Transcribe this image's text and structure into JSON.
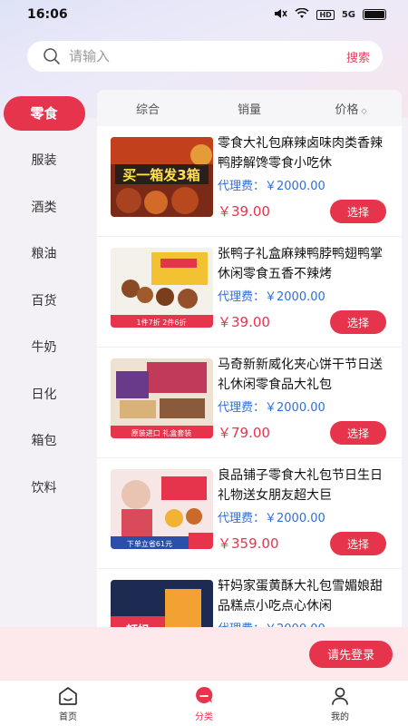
{
  "status": {
    "time": "16:06",
    "signal_text": "5G",
    "hd_text": "HD"
  },
  "search": {
    "placeholder": "请输入",
    "button_label": "搜索"
  },
  "sidebar": {
    "items": [
      {
        "label": "零食",
        "active": true
      },
      {
        "label": "服装"
      },
      {
        "label": "酒类"
      },
      {
        "label": "粮油"
      },
      {
        "label": "百货"
      },
      {
        "label": "牛奶"
      },
      {
        "label": "日化"
      },
      {
        "label": "箱包"
      },
      {
        "label": "饮料"
      }
    ]
  },
  "sort_tabs": [
    {
      "label": "综合"
    },
    {
      "label": "销量"
    },
    {
      "label": "价格",
      "icon": "sort-arrows-icon",
      "icon_glyph": "⬦"
    }
  ],
  "products": [
    {
      "title": "零食大礼包麻辣卤味肉类香辣鸭脖解馋零食小吃休",
      "agent_fee": "代理费：￥2000.00",
      "price": "￥39.00",
      "button": "选择",
      "image_text": "买一箱发3箱"
    },
    {
      "title": "张鸭子礼盒麻辣鸭脖鸭翅鸭掌休闲零食五香不辣烤",
      "agent_fee": "代理费：￥2000.00",
      "price": "￥39.00",
      "button": "选择",
      "image_text": "1件7折 2件6折"
    },
    {
      "title": "马奇新新威化夹心饼干节日送礼休闲零食品大礼包",
      "agent_fee": "代理费：￥2000.00",
      "price": "￥79.00",
      "button": "选择",
      "image_text": "原装进口 礼盒套装"
    },
    {
      "title": "良品铺子零食大礼包节日生日礼物送女朋友超大巨",
      "agent_fee": "代理费：￥2000.00",
      "price": "￥359.00",
      "button": "选择",
      "image_text": "下单立省61元"
    },
    {
      "title": "轩妈家蛋黄酥大礼包雪媚娘甜品糕点小吃点心休闲",
      "agent_fee": "代理费：￥2000.00",
      "price": "",
      "button": "",
      "image_text": "轩妈"
    }
  ],
  "login": {
    "button_label": "请先登录"
  },
  "tabbar": [
    {
      "label": "首页",
      "icon": "home-icon"
    },
    {
      "label": "分类",
      "icon": "category-icon",
      "active": true
    },
    {
      "label": "我的",
      "icon": "profile-icon"
    }
  ],
  "colors": {
    "accent": "#e7344d",
    "agent_blue": "#2f6fd6",
    "login_bg": "#fde9ec"
  }
}
